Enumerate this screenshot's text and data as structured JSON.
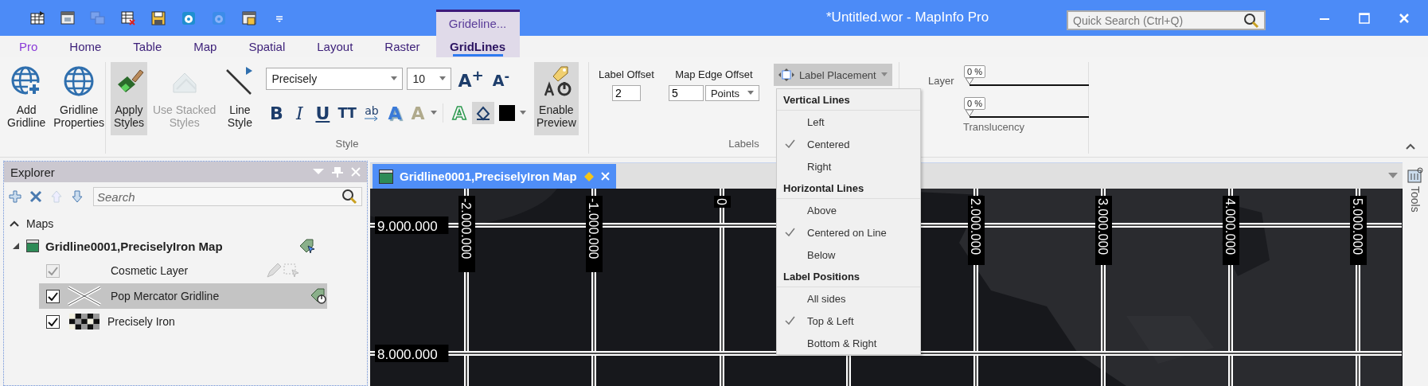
{
  "window": {
    "title": "*Untitled.wor - MapInfo Pro"
  },
  "quick_access": [
    {
      "kind": "new-table",
      "disabled": false
    },
    {
      "kind": "open-window",
      "disabled": false
    },
    {
      "kind": "windows",
      "disabled": true
    },
    {
      "kind": "close-table",
      "disabled": false
    },
    {
      "kind": "save",
      "disabled": false
    },
    {
      "kind": "disc",
      "disabled": false
    },
    {
      "kind": "disc",
      "disabled": true
    },
    {
      "kind": "save-window",
      "disabled": false
    },
    {
      "kind": "customize",
      "disabled": false
    }
  ],
  "quick_search": {
    "placeholder": "Quick Search (Ctrl+Q)"
  },
  "tabs": [
    {
      "label": "Pro",
      "kind": "file",
      "selected": false
    },
    {
      "label": "Home",
      "kind": "normal",
      "selected": false
    },
    {
      "label": "Table",
      "kind": "normal",
      "selected": false
    },
    {
      "label": "Map",
      "kind": "normal",
      "selected": false
    },
    {
      "label": "Spatial",
      "kind": "normal",
      "selected": false
    },
    {
      "label": "Layout",
      "kind": "normal",
      "selected": false
    },
    {
      "label": "Raster",
      "kind": "normal",
      "selected": false
    },
    {
      "label": "GridLines",
      "kind": "context",
      "selected": true
    }
  ],
  "context_group": {
    "label": "Grideline..."
  },
  "ribbon": {
    "gridline_buttons": [
      {
        "label": "Add\nGridline",
        "kind": "add-gridline",
        "pressed": false,
        "disabled": false
      },
      {
        "label": "Gridline\nProperties",
        "kind": "gridline-properties",
        "pressed": false,
        "disabled": false
      }
    ],
    "style_group": {
      "title": "Style",
      "buttons": [
        {
          "label": "Apply\nStyles",
          "kind": "apply-styles",
          "pressed": true,
          "disabled": false
        },
        {
          "label": "Use Stacked\nStyles",
          "kind": "stacked-styles",
          "pressed": false,
          "disabled": true
        },
        {
          "label": "Line\nStyle",
          "kind": "line-style",
          "pressed": false,
          "disabled": false
        }
      ],
      "font": "Precisely",
      "size": "10",
      "size_buttons": [
        {
          "kind": "grow",
          "glyph": "A$^{+}$"
        },
        {
          "kind": "shrink",
          "glyph": "A$^{-}$"
        }
      ],
      "format_buttons": [
        {
          "kind": "bold",
          "glyph": "B",
          "pressed": false,
          "disabled": false
        },
        {
          "kind": "italic",
          "glyph": "I",
          "pressed": false,
          "disabled": false
        },
        {
          "kind": "underline",
          "glyph": "U",
          "pressed": false,
          "disabled": false
        },
        {
          "kind": "caps",
          "glyph": "TT",
          "pressed": false,
          "disabled": false
        },
        {
          "kind": "wrap",
          "glyph": "ab",
          "pressed": false,
          "disabled": false
        },
        {
          "kind": "shadow",
          "glyph": "A",
          "pressed": false,
          "disabled": false
        },
        {
          "kind": "highlight",
          "glyph": "A",
          "pressed": false,
          "disabled": true
        },
        {
          "kind": "outline",
          "glyph": "A",
          "pressed": false,
          "disabled": false
        },
        {
          "kind": "halo",
          "pressed": true,
          "disabled": false
        },
        {
          "kind": "color",
          "color": "#000000",
          "pressed": false
        }
      ],
      "preview": {
        "label": "Enable\nPreview",
        "kind": "enable-preview",
        "pressed": true,
        "disabled": false
      }
    },
    "labels_group": {
      "title": "Labels",
      "label_offset": {
        "label": "Label Offset",
        "value": "2"
      },
      "map_edge_offset": {
        "label": "Map Edge Offset",
        "value": "5",
        "unit": "Points"
      },
      "label_placement": {
        "label": "Label Placement",
        "expanded": true
      }
    },
    "translucency_group": {
      "title": "Translucency",
      "rows": [
        {
          "label": "Layer",
          "reading": "0 %",
          "level": 0
        },
        {
          "reading": "0 %",
          "level": 0
        }
      ]
    }
  },
  "placement_menu": [
    {
      "title": "Vertical Lines",
      "items": [
        {
          "label": "Left",
          "checked": false
        },
        {
          "label": "Centered",
          "checked": true
        },
        {
          "label": "Right",
          "checked": false
        }
      ]
    },
    {
      "title": "Horizontal Lines",
      "items": [
        {
          "label": "Above",
          "checked": false
        },
        {
          "label": "Centered on Line",
          "checked": true
        },
        {
          "label": "Below",
          "checked": false
        }
      ]
    },
    {
      "title": "Label Positions",
      "items": [
        {
          "label": "All sides",
          "checked": false
        },
        {
          "label": "Top & Left",
          "checked": true
        },
        {
          "label": "Bottom & Right",
          "checked": false
        }
      ]
    }
  ],
  "explorer": {
    "title": "Explorer",
    "toolbar": [
      {
        "kind": "add",
        "disabled": false
      },
      {
        "kind": "remove",
        "disabled": false
      },
      {
        "kind": "up",
        "disabled": true
      },
      {
        "kind": "down",
        "disabled": false
      }
    ],
    "search": {
      "placeholder": "Search"
    },
    "tree": [
      {
        "label": "Maps",
        "kind": "category",
        "expanded": true,
        "children": [
          {
            "label": "Gridline0001,PreciselyIron Map",
            "kind": "map",
            "expanded": true,
            "children": [
              {
                "label": "Cosmetic Layer",
                "kind": "cosmetic",
                "checked": true,
                "disabled": true,
                "selected": false
              },
              {
                "label": "Pop Mercator Gridline",
                "kind": "gridline",
                "checked": true,
                "disabled": false,
                "selected": true
              },
              {
                "label": "Precisely Iron",
                "kind": "raster",
                "checked": true,
                "disabled": false,
                "selected": false
              }
            ]
          }
        ]
      }
    ]
  },
  "document_tab": {
    "title": "Gridline0001,PreciselyIron Map",
    "selected": true
  },
  "map": {
    "kind": "picture",
    "vertical_labels": [
      "-2.000.000",
      "-1.000.000",
      "0",
      "2.000.000",
      "3.000.000",
      "4.000.000",
      "5.000.000"
    ],
    "horizontal_labels": [
      "9.000.000",
      "8.000.000"
    ]
  },
  "tool_strip": {
    "label": "Tools"
  }
}
